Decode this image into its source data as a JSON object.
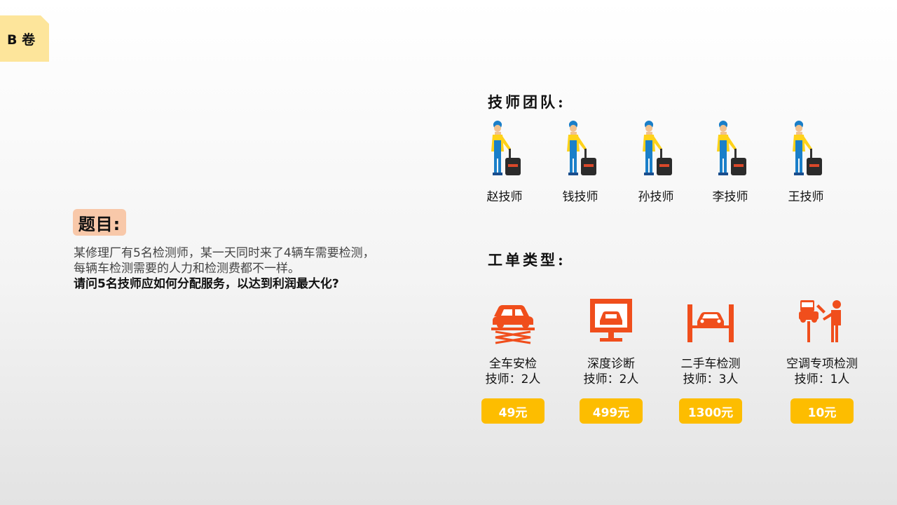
{
  "tag": "B 卷",
  "question": {
    "title": "题目:",
    "line1": "某修理厂有5名检测师，某一天同时来了4辆车需要检测，每辆车检测需要的人力和检测费都不一样。",
    "line2": "请问5名技师应如何分配服务，以达到利润最大化?"
  },
  "team": {
    "title": "技师团队:",
    "members": [
      {
        "name": "赵技师",
        "icon": "technician-with-toolbox-icon"
      },
      {
        "name": "钱技师",
        "icon": "technician-with-toolbox-icon"
      },
      {
        "name": "孙技师",
        "icon": "technician-with-toolbox-icon"
      },
      {
        "name": "李技师",
        "icon": "technician-with-toolbox-icon"
      },
      {
        "name": "王技师",
        "icon": "technician-with-toolbox-icon"
      }
    ]
  },
  "work_orders": {
    "title": "工单类型:",
    "items": [
      {
        "name": "全车安检",
        "techs": "技师：2人",
        "price": "49元",
        "icon": "car-lift-icon"
      },
      {
        "name": "深度诊断",
        "techs": "技师：2人",
        "price": "499元",
        "icon": "diagnostic-monitor-icon"
      },
      {
        "name": "二手车检测",
        "techs": "技师：3人",
        "price": "1300元",
        "icon": "car-bay-icon"
      },
      {
        "name": "空调专项检测",
        "techs": "技师：1人",
        "price": "10元",
        "icon": "mechanic-repair-icon"
      }
    ]
  },
  "colors": {
    "accent_orange": "#f04e1c",
    "price_yellow": "#fdbd00",
    "tag_yellow": "#fde59b",
    "title_peach": "#f8c8a9"
  }
}
